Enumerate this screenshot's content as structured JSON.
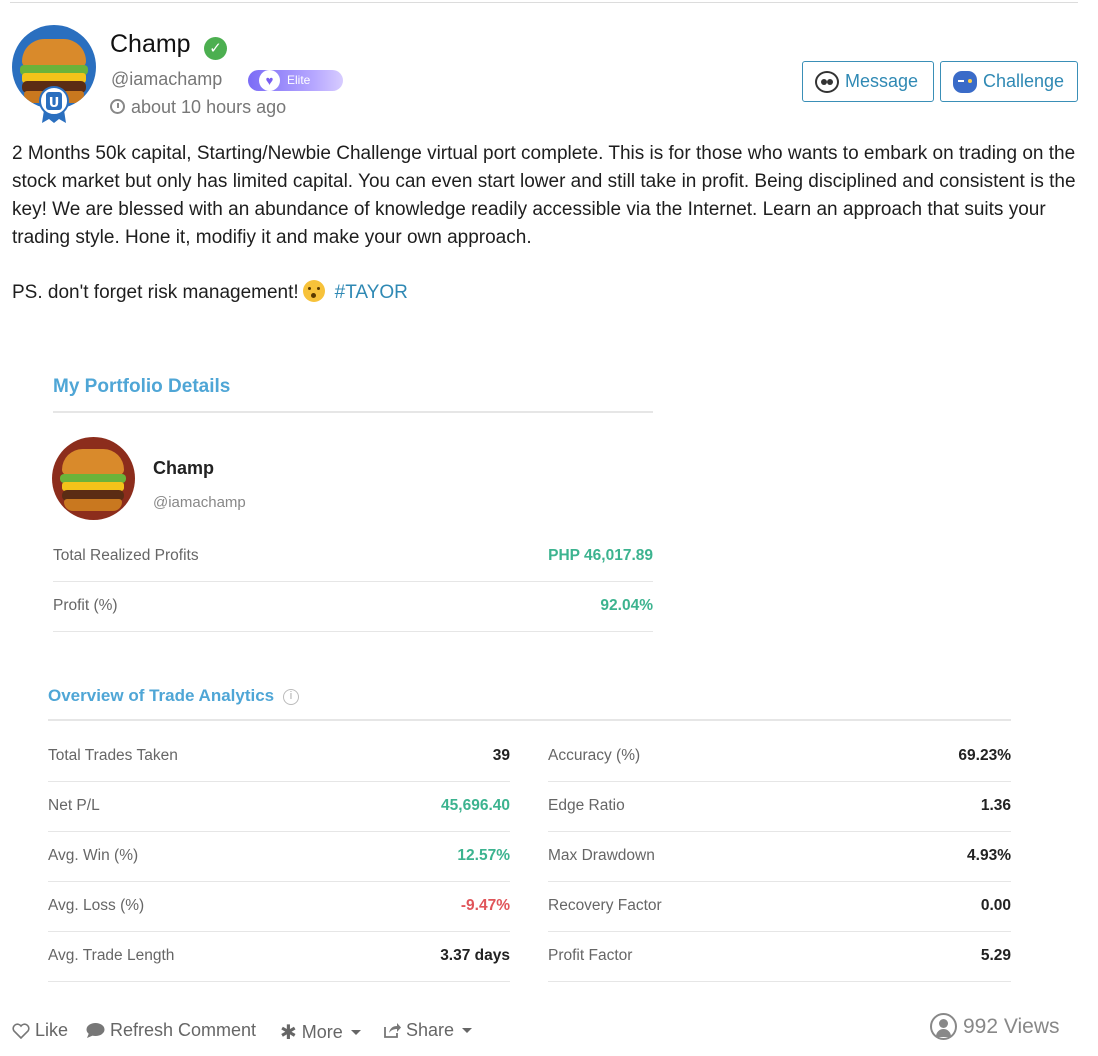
{
  "header": {
    "name": "Champ",
    "handle": "@iamachamp",
    "elite_label": "Elite",
    "timestamp": "about 10 hours ago",
    "message_label": "Message",
    "challenge_label": "Challenge",
    "icons": {
      "verified": "check-circle-icon",
      "clock": "clock-icon",
      "message": "panda-icon",
      "challenge": "gamepad-icon"
    }
  },
  "post": {
    "body": "2 Months 50k capital, Starting/Newbie Challenge virtual port complete. This is for those who wants to embark on trading on the stock market but only has limited capital. You can even start lower and still take in profit. Being disciplined and consistent is the key! We are blessed with an abundance of knowledge readily accessible via the Internet. Learn an approach that suits your trading style. Hone it, modifiy it and make your own approach.",
    "ps": "PS. don't forget risk management!",
    "hashtag": "#TAYOR"
  },
  "portfolio": {
    "title": "My Portfolio Details",
    "name": "Champ",
    "handle": "@iamachamp",
    "rows": [
      {
        "label": "Total Realized Profits",
        "value": "PHP 46,017.89"
      },
      {
        "label": "Profit (%)",
        "value": "92.04%"
      }
    ]
  },
  "analytics": {
    "title": "Overview of Trade Analytics",
    "left": [
      {
        "label": "Total Trades Taken",
        "value": "39"
      },
      {
        "label": "Net P/L",
        "value": "45,696.40"
      },
      {
        "label": "Avg. Win (%)",
        "value": "12.57%"
      },
      {
        "label": "Avg. Loss (%)",
        "value": "-9.47%"
      },
      {
        "label": "Avg. Trade Length",
        "value": "3.37 days"
      }
    ],
    "right": [
      {
        "label": "Accuracy (%)",
        "value": "69.23%"
      },
      {
        "label": "Edge Ratio",
        "value": "1.36"
      },
      {
        "label": "Max Drawdown",
        "value": "4.93%"
      },
      {
        "label": "Recovery Factor",
        "value": "0.00"
      },
      {
        "label": "Profit Factor",
        "value": "5.29"
      }
    ],
    "colors": {
      "positive": "#3cb38f",
      "negative": "#e0555a",
      "accent": "#4fa6d6"
    }
  },
  "footer": {
    "like_label": "Like",
    "refresh_label": "Refresh Comment",
    "more_label": "More",
    "share_label": "Share",
    "views_label": "992 Views"
  }
}
